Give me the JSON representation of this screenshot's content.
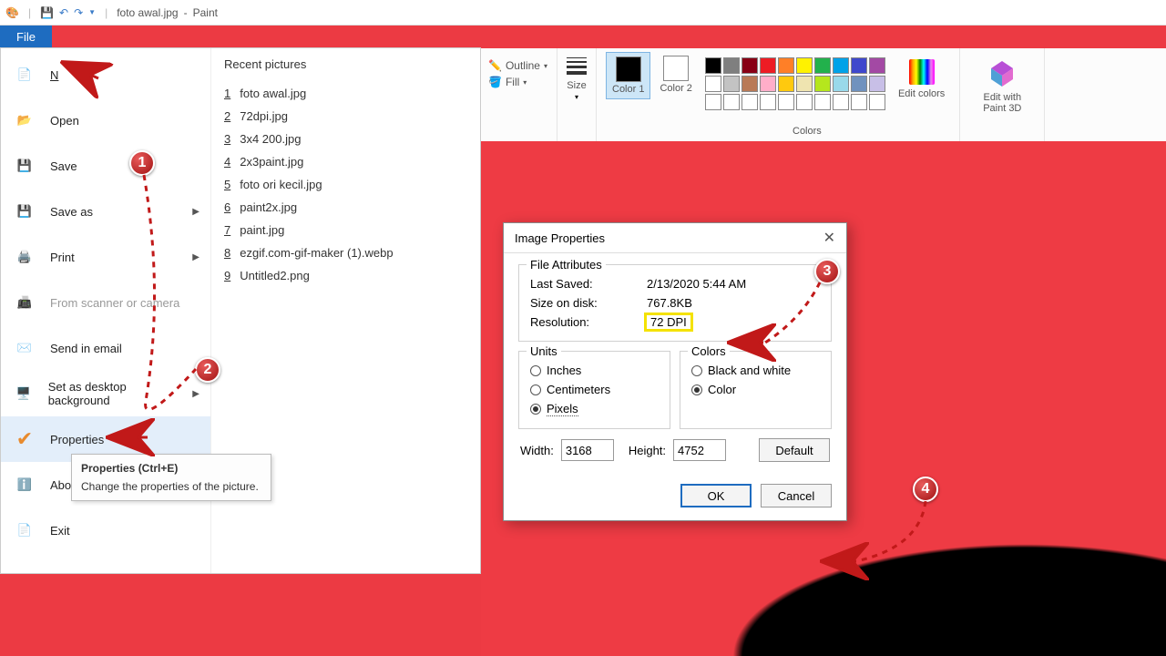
{
  "window": {
    "filename": "foto awal.jpg",
    "app": "Paint"
  },
  "file_tab": "File",
  "menu": {
    "new": "New",
    "open": "Open",
    "save": "Save",
    "saveas": "Save as",
    "print": "Print",
    "scanner": "From scanner or camera",
    "email": "Send in email",
    "setbg": "Set as desktop background",
    "properties": "Properties",
    "about": "About",
    "exit": "Exit"
  },
  "recent": {
    "title": "Recent pictures",
    "items": [
      "foto awal.jpg",
      "72dpi.jpg",
      "3x4 200.jpg",
      "2x3paint.jpg",
      "foto ori kecil.jpg",
      "paint2x.jpg",
      "paint.jpg",
      "ezgif.com-gif-maker (1).webp",
      "Untitled2.png"
    ]
  },
  "tooltip": {
    "title": "Properties (Ctrl+E)",
    "body": "Change the properties of the picture."
  },
  "ribbon": {
    "outline": "Outline",
    "fill": "Fill",
    "size": "Size",
    "color1": "Color 1",
    "color2": "Color 2",
    "colors_label": "Colors",
    "editcolors": "Edit colors",
    "paint3d": "Edit with Paint 3D",
    "color1_hex": "#000000",
    "color2_hex": "#ffffff",
    "palette": [
      "#000",
      "#7f7f7f",
      "#880015",
      "#ed1c24",
      "#ff7f27",
      "#fff200",
      "#22b14c",
      "#00a2e8",
      "#3f48cc",
      "#a349a4",
      "#fff",
      "#c3c3c3",
      "#b97a57",
      "#ffaec9",
      "#ffc90e",
      "#efe4b0",
      "#b5e61d",
      "#99d9ea",
      "#7092be",
      "#c8bfe7",
      "#fff",
      "#fff",
      "#fff",
      "#fff",
      "#fff",
      "#fff",
      "#fff",
      "#fff",
      "#fff",
      "#fff"
    ]
  },
  "dialog": {
    "title": "Image Properties",
    "attrs_label": "File Attributes",
    "last_saved_k": "Last Saved:",
    "last_saved_v": "2/13/2020 5:44 AM",
    "size_k": "Size on disk:",
    "size_v": "767.8KB",
    "resolution_k": "Resolution:",
    "resolution_v": "72 DPI",
    "units_label": "Units",
    "colors_label": "Colors",
    "inches": "Inches",
    "cm": "Centimeters",
    "pixels": "Pixels",
    "bw": "Black and white",
    "color": "Color",
    "width_label": "Width:",
    "width_value": "3168",
    "height_label": "Height:",
    "height_value": "4752",
    "default": "Default",
    "ok": "OK",
    "cancel": "Cancel"
  },
  "steps": {
    "s1": "1",
    "s2": "2",
    "s3": "3",
    "s4": "4"
  }
}
